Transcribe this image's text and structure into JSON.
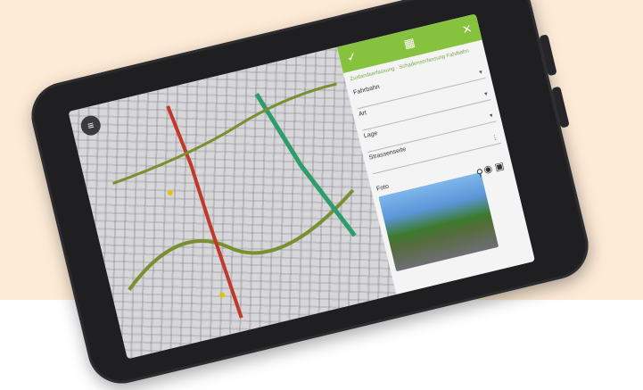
{
  "photo": {
    "kind": "product photo of a rugged tablet showing a field-mapping app",
    "background_color": "#fdebd7",
    "device_color": "#1f1f22",
    "accent_color": "#86c23d"
  },
  "map": {
    "menu_icon": "layers-icon",
    "road_colors": [
      "#c0392b",
      "#7a8f2f",
      "#2e9c6b",
      "#e2c400"
    ]
  },
  "form": {
    "header_icons": [
      "check-icon",
      "grid-icon",
      "close-icon"
    ],
    "tabs": "Zustandserfassung · Schadenserfassung Fahrbahn",
    "fields": [
      {
        "label": "Fahrbahn"
      },
      {
        "label": "Art"
      },
      {
        "label": "Lage"
      },
      {
        "label": "Strassenseite"
      }
    ],
    "photo_label": "Foto",
    "photo_icons": [
      "camera-icon",
      "gallery-icon"
    ]
  }
}
